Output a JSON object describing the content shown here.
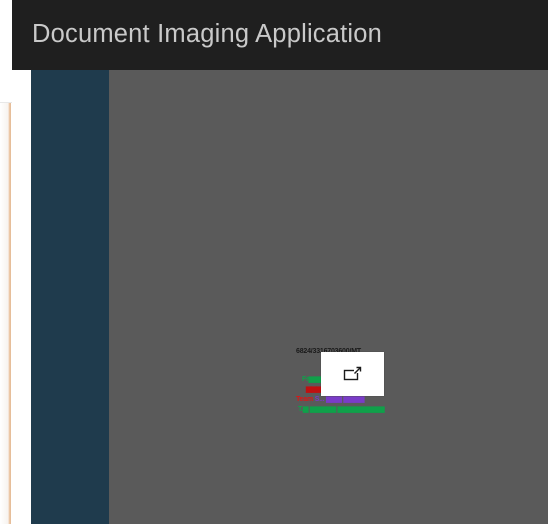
{
  "app": {
    "title": "Document Imaging Application"
  },
  "document_thumbnail": {
    "line_1": "6824/3316703600/MT",
    "line_2_green": "Fr▆▆▆▆▆▆▆▆▆▆▆▆ S",
    "line_3_red": "▆▆▆▆▆▆▆▆▆▆",
    "line_4_red": "Team",
    "line_4_purple": "S... ▆▆▆ ▆▆▆▆",
    "line_5_green": "T.▆ ▆▆▆▆▆ ▆▆▆▆▆▆▆▆▆"
  },
  "popout": {
    "icon": "open-in-new-window-icon"
  },
  "colors": {
    "title_bar": "#1f1f1f",
    "title_text": "#c9c9c9",
    "nav_strip": "#1f3b4d",
    "viewer_background": "#5a5a5a",
    "popout_button": "#ffffff"
  }
}
